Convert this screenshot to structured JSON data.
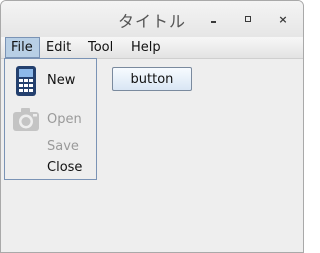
{
  "window": {
    "title": "タイトル",
    "controls": {
      "minimize": "-",
      "maximize": "□",
      "close": "×"
    }
  },
  "menubar": {
    "items": [
      {
        "label": "File",
        "active": true
      },
      {
        "label": "Edit"
      },
      {
        "label": "Tool"
      },
      {
        "label": "Help"
      }
    ]
  },
  "file_menu": {
    "items": [
      {
        "label": "New",
        "icon": "calculator-icon",
        "enabled": true
      },
      {
        "label": "Open",
        "icon": "camera-icon",
        "enabled": false
      },
      {
        "label": "Save",
        "enabled": false
      },
      {
        "label": "Close",
        "enabled": true
      }
    ]
  },
  "content": {
    "button_label": "button"
  },
  "colors": {
    "menu_highlight": "#b8cfe5",
    "menu_border": "#7a93b5",
    "disabled_text": "#9a9a9a",
    "window_background": "#eeeeee"
  }
}
